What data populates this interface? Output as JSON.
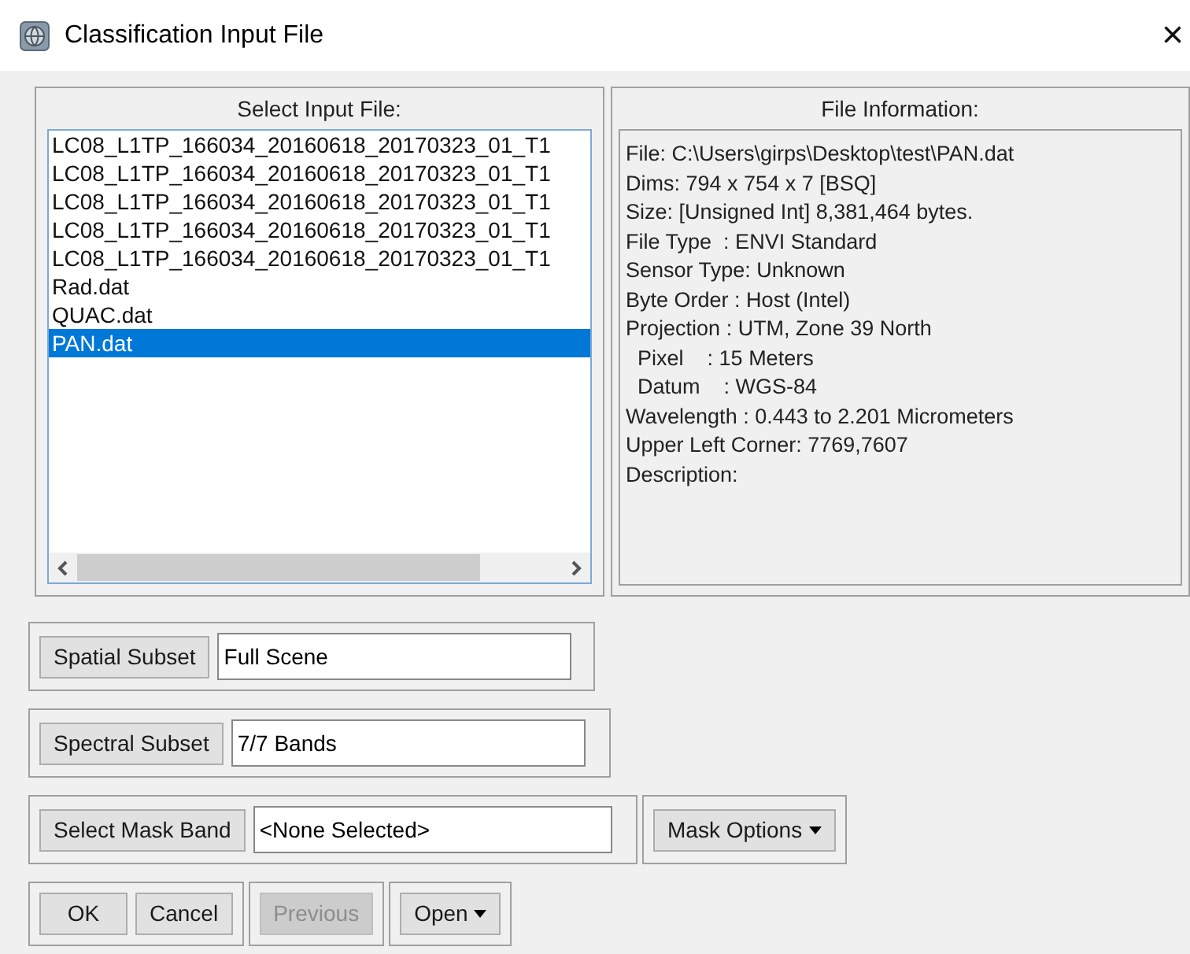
{
  "window": {
    "title": "Classification Input File",
    "close": "×"
  },
  "input_list": {
    "title": "Select Input File:",
    "items": [
      {
        "label": "LC08_L1TP_166034_20160618_20170323_01_T1",
        "selected": false
      },
      {
        "label": "LC08_L1TP_166034_20160618_20170323_01_T1",
        "selected": false
      },
      {
        "label": "LC08_L1TP_166034_20160618_20170323_01_T1",
        "selected": false
      },
      {
        "label": "LC08_L1TP_166034_20160618_20170323_01_T1",
        "selected": false
      },
      {
        "label": "LC08_L1TP_166034_20160618_20170323_01_T1",
        "selected": false
      },
      {
        "label": "Rad.dat",
        "selected": false
      },
      {
        "label": "QUAC.dat",
        "selected": false
      },
      {
        "label": "PAN.dat",
        "selected": true
      }
    ]
  },
  "file_info": {
    "title": "File Information:",
    "lines": [
      "File: C:\\Users\\girps\\Desktop\\test\\PAN.dat",
      "Dims: 794 x 754 x 7 [BSQ]",
      "Size: [Unsigned Int] 8,381,464 bytes.",
      "File Type  : ENVI Standard",
      "Sensor Type: Unknown",
      "Byte Order : Host (Intel)",
      "Projection : UTM, Zone 39 North",
      "  Pixel    : 15 Meters",
      "  Datum    : WGS-84",
      "Wavelength : 0.443 to 2.201 Micrometers",
      "Upper Left Corner: 7769,7607",
      "Description:"
    ]
  },
  "subsets": [
    {
      "button": "Spatial Subset",
      "value": "Full Scene"
    },
    {
      "button": "Spectral Subset",
      "value": "7/7 Bands"
    },
    {
      "button": "Select Mask Band",
      "value": "<None Selected>"
    }
  ],
  "mask_options": {
    "label": "Mask Options"
  },
  "buttons": [
    {
      "label": "OK",
      "disabled": false
    },
    {
      "label": "Cancel",
      "disabled": false
    },
    {
      "label": "Previous",
      "disabled": true
    }
  ],
  "open_menu": {
    "label": "Open"
  }
}
